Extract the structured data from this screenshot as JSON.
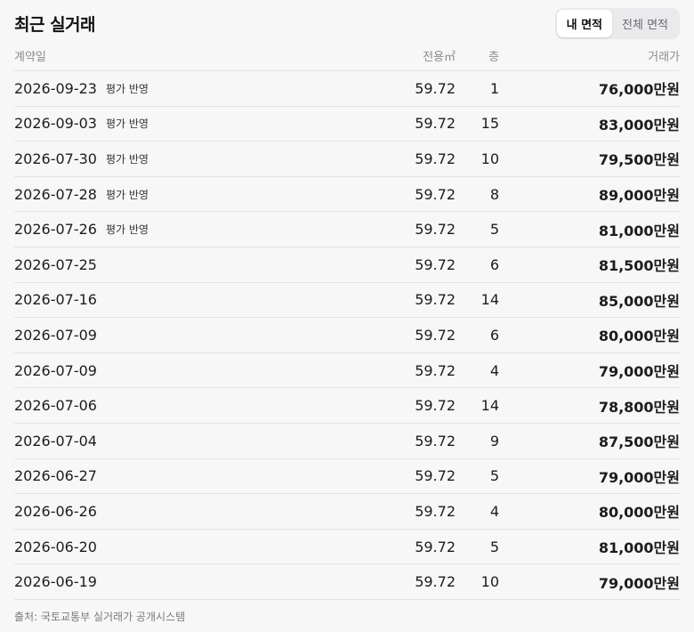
{
  "header": {
    "title": "최근 실거래",
    "toggle": {
      "my_area": "내 면적",
      "all_area": "전체 면적",
      "selected": "my_area"
    }
  },
  "columns": {
    "date": "계약일",
    "area": "전용㎡",
    "floor": "층",
    "price": "거래가"
  },
  "rows": [
    {
      "date": "2026-09-23",
      "badge": "평가 반영",
      "area": "59.72",
      "floor": "1",
      "price": "76,000만원"
    },
    {
      "date": "2026-09-03",
      "badge": "평가 반영",
      "area": "59.72",
      "floor": "15",
      "price": "83,000만원"
    },
    {
      "date": "2026-07-30",
      "badge": "평가 반영",
      "area": "59.72",
      "floor": "10",
      "price": "79,500만원"
    },
    {
      "date": "2026-07-28",
      "badge": "평가 반영",
      "area": "59.72",
      "floor": "8",
      "price": "89,000만원"
    },
    {
      "date": "2026-07-26",
      "badge": "평가 반영",
      "area": "59.72",
      "floor": "5",
      "price": "81,000만원"
    },
    {
      "date": "2026-07-25",
      "badge": "",
      "area": "59.72",
      "floor": "6",
      "price": "81,500만원"
    },
    {
      "date": "2026-07-16",
      "badge": "",
      "area": "59.72",
      "floor": "14",
      "price": "85,000만원"
    },
    {
      "date": "2026-07-09",
      "badge": "",
      "area": "59.72",
      "floor": "6",
      "price": "80,000만원"
    },
    {
      "date": "2026-07-09",
      "badge": "",
      "area": "59.72",
      "floor": "4",
      "price": "79,000만원"
    },
    {
      "date": "2026-07-06",
      "badge": "",
      "area": "59.72",
      "floor": "14",
      "price": "78,800만원"
    },
    {
      "date": "2026-07-04",
      "badge": "",
      "area": "59.72",
      "floor": "9",
      "price": "87,500만원"
    },
    {
      "date": "2026-06-27",
      "badge": "",
      "area": "59.72",
      "floor": "5",
      "price": "79,000만원"
    },
    {
      "date": "2026-06-26",
      "badge": "",
      "area": "59.72",
      "floor": "4",
      "price": "80,000만원"
    },
    {
      "date": "2026-06-20",
      "badge": "",
      "area": "59.72",
      "floor": "5",
      "price": "81,000만원"
    },
    {
      "date": "2026-06-19",
      "badge": "",
      "area": "59.72",
      "floor": "10",
      "price": "79,000만원"
    }
  ],
  "footer": {
    "source": "출처: 국토교통부 실거래가 공개시스템"
  },
  "colors": {
    "background": "#f7f7f8",
    "divider": "#e2e2e4",
    "muted": "#8b8b90"
  }
}
